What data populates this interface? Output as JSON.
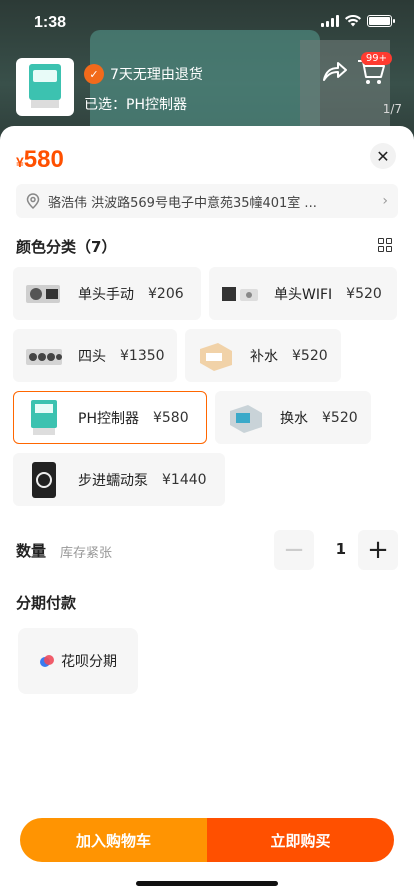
{
  "status": {
    "time": "1:38"
  },
  "header": {
    "promo": "7天无理由退货",
    "selected_label": "已选：PH控制器",
    "cart_badge": "99+",
    "pager": "1/7"
  },
  "sheet": {
    "price_currency": "¥",
    "price": "580",
    "address": "骆浩伟 洪波路569号电子中意苑35幢401室 ...",
    "color_section": "颜色分类（7）",
    "options": [
      {
        "name": "单头手动",
        "price": "¥206"
      },
      {
        "name": "单头WIFI",
        "price": "¥520"
      },
      {
        "name": "四头",
        "price": "¥1350"
      },
      {
        "name": "补水",
        "price": "¥520"
      },
      {
        "name": "PH控制器",
        "price": "¥580"
      },
      {
        "name": "换水",
        "price": "¥520"
      },
      {
        "name": "步进蠕动泵",
        "price": "¥1440"
      }
    ],
    "quantity_label": "数量",
    "stock_note": "库存紧张",
    "quantity": "1",
    "installment_section": "分期付款",
    "installment_option": "花呗分期",
    "add_to_cart": "加入购物车",
    "buy_now": "立即购买"
  },
  "colors": {
    "accent": "#ff5000",
    "cart_button": "#ff9402",
    "selected_border": "#ff6600"
  }
}
